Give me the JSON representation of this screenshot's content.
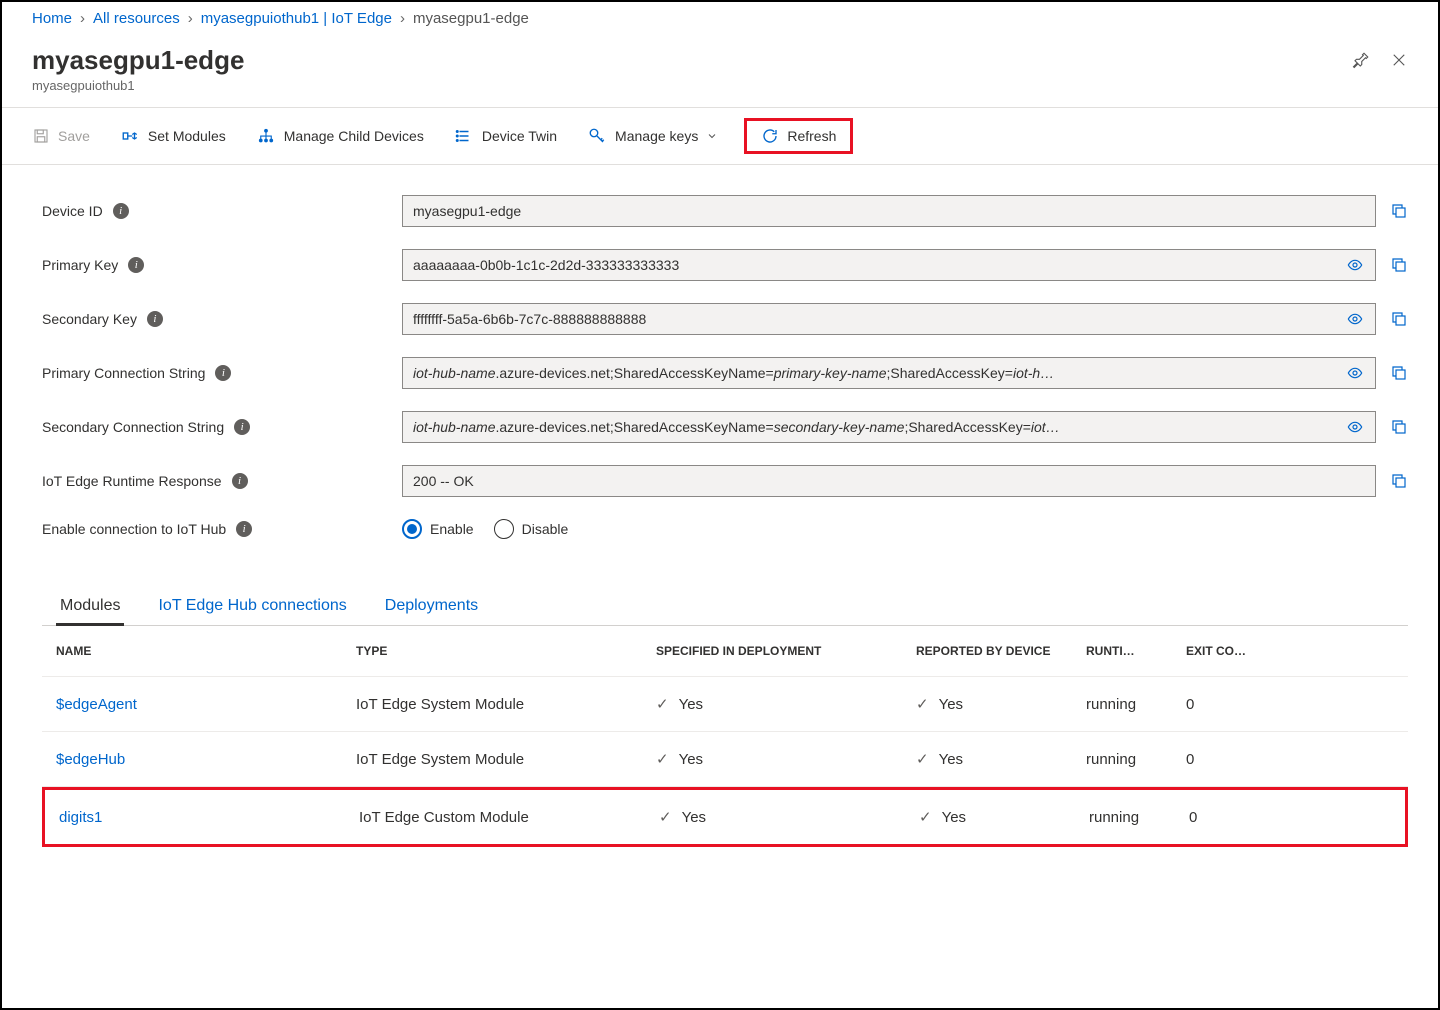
{
  "breadcrumb": {
    "items": [
      "Home",
      "All resources",
      "myasegpuiothub1 | IoT Edge"
    ],
    "current": "myasegpu1-edge"
  },
  "header": {
    "title": "myasegpu1-edge",
    "subtitle": "myasegpuiothub1"
  },
  "toolbar": {
    "save": "Save",
    "set_modules": "Set Modules",
    "manage_child": "Manage Child Devices",
    "device_twin": "Device Twin",
    "manage_keys": "Manage keys",
    "refresh": "Refresh"
  },
  "fields": {
    "device_id": {
      "label": "Device ID",
      "value": "myasegpu1-edge"
    },
    "primary_key": {
      "label": "Primary Key",
      "value": "aaaaaaaa-0b0b-1c1c-2d2d-333333333333"
    },
    "secondary_key": {
      "label": "Secondary Key",
      "value": "ffffffff-5a5a-6b6b-7c7c-888888888888"
    },
    "primary_conn": {
      "label": "Primary Connection String",
      "prefix_italic": "iot-hub-name",
      "mid": ".azure-devices.net;SharedAccessKeyName=",
      "mid_italic": "primary-key-name",
      "suffix": ";SharedAccessKey=",
      "suffix_italic": "iot-h…"
    },
    "secondary_conn": {
      "label": "Secondary Connection String",
      "prefix_italic": "iot-hub-name",
      "mid": ".azure-devices.net;SharedAccessKeyName=",
      "mid_italic": "secondary-key-name",
      "suffix": ";SharedAccessKey=",
      "suffix_italic": "iot…"
    },
    "runtime_response": {
      "label": "IoT Edge Runtime Response",
      "value": "200 -- OK"
    },
    "enable_conn": {
      "label": "Enable connection to IoT Hub",
      "enable": "Enable",
      "disable": "Disable"
    }
  },
  "tabs": {
    "modules": "Modules",
    "connections": "IoT Edge Hub connections",
    "deployments": "Deployments"
  },
  "table": {
    "headers": {
      "name": "NAME",
      "type": "TYPE",
      "specified": "SPECIFIED IN DEPLOYMENT",
      "reported": "REPORTED BY DEVICE",
      "runtime": "RUNTI…",
      "exit": "EXIT CO…"
    },
    "rows": [
      {
        "name": "$edgeAgent",
        "type": "IoT Edge System Module",
        "specified": "Yes",
        "reported": "Yes",
        "runtime": "running",
        "exit": "0"
      },
      {
        "name": "$edgeHub",
        "type": "IoT Edge System Module",
        "specified": "Yes",
        "reported": "Yes",
        "runtime": "running",
        "exit": "0"
      },
      {
        "name": "digits1",
        "type": "IoT Edge Custom Module",
        "specified": "Yes",
        "reported": "Yes",
        "runtime": "running",
        "exit": "0"
      }
    ]
  }
}
